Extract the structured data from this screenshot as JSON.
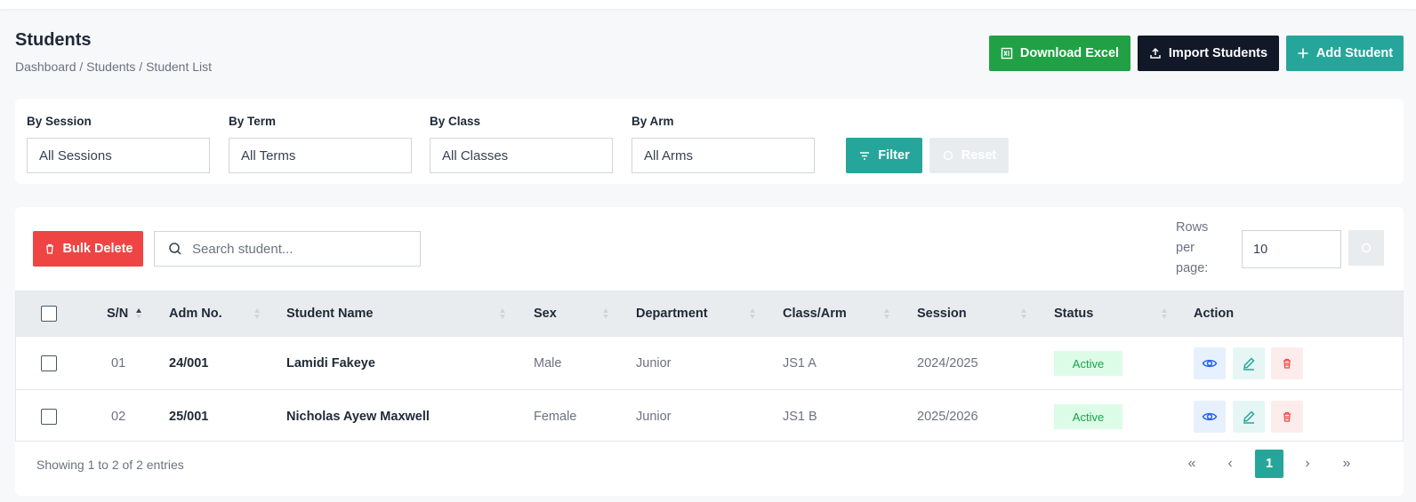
{
  "page": {
    "title": "Students",
    "breadcrumb": "Dashboard / Students / Student List"
  },
  "header_actions": {
    "download_excel": "Download Excel",
    "import_students": "Import Students",
    "add_student": "Add Student"
  },
  "filters": {
    "session": {
      "label": "By Session",
      "value": "All Sessions"
    },
    "term": {
      "label": "By Term",
      "value": "All Terms"
    },
    "class": {
      "label": "By Class",
      "value": "All Classes"
    },
    "arm": {
      "label": "By Arm",
      "value": "All Arms"
    },
    "filter_button": "Filter",
    "reset_button": "Reset"
  },
  "toolbar": {
    "bulk_delete": "Bulk Delete",
    "search_placeholder": "Search student...",
    "rows_per_page_label": "Rows per page:",
    "rows_per_page_value": "10"
  },
  "table": {
    "columns": [
      "S/N",
      "Adm No.",
      "Student Name",
      "Sex",
      "Department",
      "Class/Arm",
      "Session",
      "Status",
      "Action"
    ],
    "rows": [
      {
        "sn": "01",
        "adm": "24/001",
        "name": "Lamidi Fakeye",
        "sex": "Male",
        "department": "Junior",
        "class_arm": "JS1 A",
        "session": "2024/2025",
        "status": "Active"
      },
      {
        "sn": "02",
        "adm": "25/001",
        "name": "Nicholas Ayew Maxwell",
        "sex": "Female",
        "department": "Junior",
        "class_arm": "JS1 B",
        "session": "2025/2026",
        "status": "Active"
      }
    ]
  },
  "footer": {
    "showing": "Showing 1 to 2 of 2 entries",
    "pagination": {
      "first": "«",
      "prev": "‹",
      "current": "1",
      "next": "›",
      "last": "»"
    }
  },
  "colors": {
    "excel_green": "#20a145",
    "dark_navy": "#111827",
    "teal": "#26a69a",
    "danger_red": "#ef4444",
    "active_badge_bg": "#dcfce7",
    "active_badge_text": "#16a34a"
  }
}
